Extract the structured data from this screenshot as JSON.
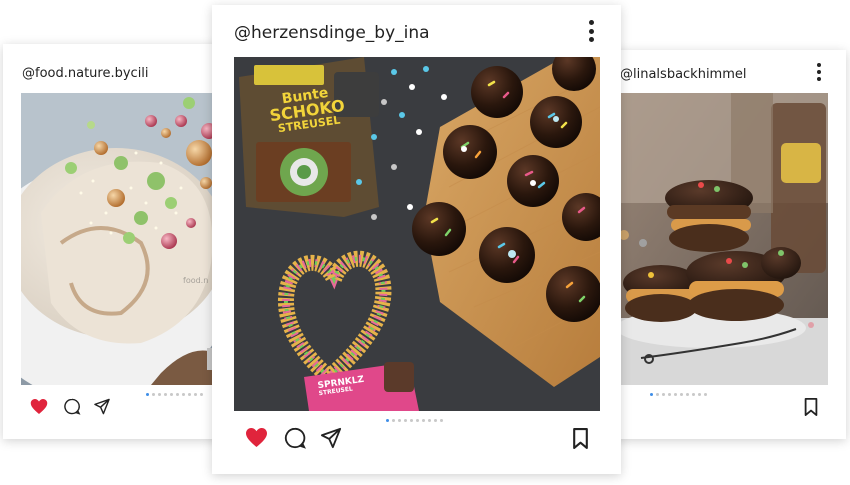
{
  "posts": {
    "left": {
      "username": "@food.nature.bycili",
      "watermark": "food.n"
    },
    "center": {
      "username": "@herzensdinge_by_ina",
      "package": {
        "line1": "Bunte",
        "line2": "SCHOKO",
        "line3": "STREUSEL"
      },
      "bag_label": {
        "line1": "SPRNKLZ",
        "line2": "STREUSEL"
      }
    },
    "right": {
      "username": "@linalsbackhimmel"
    }
  },
  "icons": {
    "like": "heart-icon",
    "comment": "comment-icon",
    "share": "send-icon",
    "save": "bookmark-icon",
    "menu": "more-vertical-icon"
  },
  "colors": {
    "like": "#e0243c",
    "pager_active": "#3f8ee8",
    "pager_inactive": "#c9c9c9",
    "text": "#222222"
  }
}
